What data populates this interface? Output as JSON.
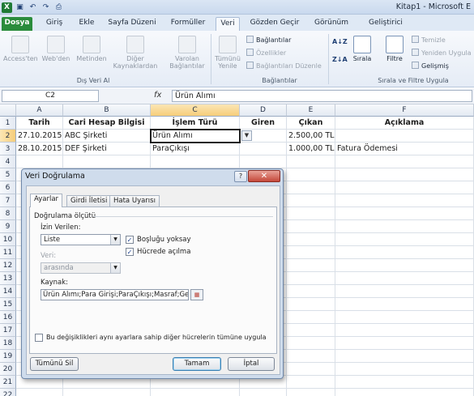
{
  "window": {
    "title": "Kitap1 - Microsoft E",
    "qat_icons": [
      "excel-logo",
      "save-icon",
      "undo-icon",
      "redo-icon",
      "print-preview-icon"
    ]
  },
  "ribbon": {
    "tabs": [
      "Dosya",
      "Giriş",
      "Ekle",
      "Sayfa Düzeni",
      "Formüller",
      "Veri",
      "Gözden Geçir",
      "Görünüm",
      "Geliştirici"
    ],
    "active_tab": "Veri",
    "external_data": {
      "access": "Access'ten",
      "web": "Web'den",
      "text": "Metinden",
      "other_1": "Diğer",
      "other_2": "Kaynaklardan",
      "existing_1": "Varolan",
      "existing_2": "Bağlantılar",
      "group_label": "Dış Veri Al"
    },
    "connections": {
      "refresh_1": "Tümünü",
      "refresh_2": "Yenile",
      "connections": "Bağlantılar",
      "properties": "Özellikler",
      "edit_links": "Bağlantıları Düzenle",
      "group_label": "Bağlantılar"
    },
    "sort_filter": {
      "sort_az": "A↓Z",
      "sort_za": "Z↓A",
      "sort": "Sırala",
      "filter": "Filtre",
      "clear": "Temizle",
      "reapply": "Yeniden Uygula",
      "advanced": "Gelişmiş",
      "group_label": "Sırala ve Filtre Uygula"
    }
  },
  "formula_bar": {
    "name_box": "C2",
    "fx": "fx",
    "formula": "Ürün Alımı"
  },
  "sheet": {
    "columns": [
      "A",
      "B",
      "C",
      "D",
      "E",
      "F"
    ],
    "rows": [
      "1",
      "2",
      "3",
      "4",
      "5",
      "6",
      "7",
      "8",
      "9",
      "10",
      "11",
      "12",
      "13",
      "14",
      "15",
      "16",
      "17",
      "18",
      "19",
      "20",
      "21",
      "22"
    ],
    "headers": {
      "a": "Tarih",
      "b": "Cari Hesap Bilgisi",
      "c": "İşlem Türü",
      "d": "Giren",
      "e": "Çıkan",
      "f": "Açıklama"
    },
    "row2": {
      "a": "27.10.2015",
      "b": "ABC Şirketi",
      "c": "Ürün Alımı",
      "d": "",
      "e": "2.500,00 TL",
      "f": ""
    },
    "row3": {
      "a": "28.10.2015",
      "b": "DEF Şirketi",
      "c": "ParaÇıkışı",
      "d": "",
      "e": "1.000,00 TL",
      "f": "Fatura Ödemesi"
    }
  },
  "dialog": {
    "title": "Veri Doğrulama",
    "help": "?",
    "close": "✕",
    "tabs": [
      "Ayarlar",
      "Girdi İletisi",
      "Hata Uyarısı"
    ],
    "section": "Doğrulama ölçütü",
    "allow_label": "İzin Verilen:",
    "allow_value": "Liste",
    "ignore_blank": "Boşluğu yoksay",
    "in_cell_dropdown": "Hücrede açılma",
    "data_label": "Veri:",
    "data_value": "arasında",
    "source_label": "Kaynak:",
    "source_value": "Ürün Alımı;Para Girişi;ParaÇıkışı;Masraf;Genel Ç",
    "apply_all": "Bu değişiklikleri aynı ayarlara sahip diğer hücrelerin tümüne uygula",
    "clear_all": "Tümünü Sil",
    "ok": "Tamam",
    "cancel": "İptal"
  }
}
